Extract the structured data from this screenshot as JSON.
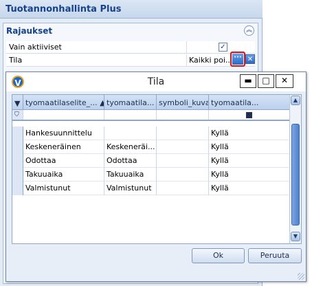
{
  "app": {
    "title": "Tuotannonhallinta Plus",
    "section_title": "Rajaukset",
    "collapse_icon": "double-chevron-up-icon",
    "rows": [
      {
        "label": "Vain aktiiviset",
        "checked": true
      },
      {
        "label": "Tila",
        "value": "Kaikki poi..."
      }
    ]
  },
  "dialog": {
    "title": "Tila",
    "logo_letter": "V",
    "columns": [
      "tyomaatilaselite_...",
      "tyomaatila...",
      "symboli_kuva",
      "tyomaatila..."
    ],
    "rows": [
      {
        "c1": "Hankesuunnittelu",
        "c2": "",
        "c3": "",
        "c4": "Kyllä"
      },
      {
        "c1": "Keskeneräinen",
        "c2": "Keskeneräi...",
        "c3": "",
        "c4": "Kyllä"
      },
      {
        "c1": "Odottaa",
        "c2": "Odottaa",
        "c3": "",
        "c4": "Kyllä"
      },
      {
        "c1": "Takuuaika",
        "c2": "Takuuaika",
        "c3": "",
        "c4": "Kyllä"
      },
      {
        "c1": "Valmistunut",
        "c2": "Valmistunut",
        "c3": "",
        "c4": "Kyllä"
      }
    ],
    "ok_label": "Ok",
    "cancel_label": "Peruuta"
  }
}
